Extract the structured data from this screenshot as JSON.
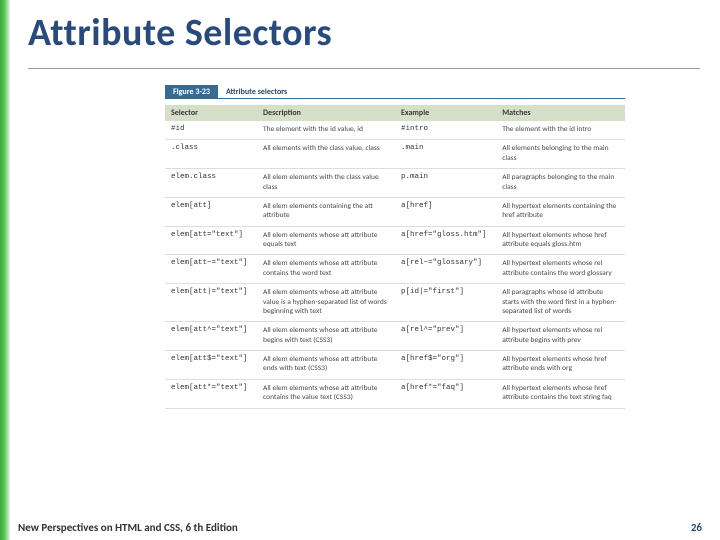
{
  "title": "Attribute Selectors",
  "figure": {
    "number": "Figure 3-23",
    "caption": "Attribute selectors",
    "headers": [
      "Selector",
      "Description",
      "Example",
      "Matches"
    ],
    "rows": [
      {
        "selector": "#id",
        "description": "The element with the id value, id",
        "example": "#intro",
        "matches": "The element with the id intro"
      },
      {
        "selector": ".class",
        "description": "All elements with the class value, class",
        "example": ".main",
        "matches": "All elements belonging to the main class"
      },
      {
        "selector": "elem.class",
        "description": "All elem elements with the class value class",
        "example": "p.main",
        "matches": "All paragraphs belonging to the main class"
      },
      {
        "selector": "elem[att]",
        "description": "All elem elements containing the att attribute",
        "example": "a[href]",
        "matches": "All hypertext elements containing the href attribute"
      },
      {
        "selector": "elem[att=\"text\"]",
        "description": "All elem elements whose att attribute equals text",
        "example": "a[href=\"gloss.htm\"]",
        "matches": "All hypertext elements whose href attribute equals gloss.htm"
      },
      {
        "selector": "elem[att~=\"text\"]",
        "description": "All elem elements whose att attribute contains the word text",
        "example": "a[rel~=\"glossary\"]",
        "matches": "All hypertext elements whose rel attribute contains the word glossary"
      },
      {
        "selector": "elem[att|=\"text\"]",
        "description": "All elem elements whose att attribute value is a hyphen-separated list of words beginning with text",
        "example": "p[id|=\"first\"]",
        "matches": "All paragraphs whose id attribute starts with the word first in a hyphen-separated list of words"
      },
      {
        "selector": "elem[att^=\"text\"]",
        "description": "All elem elements whose att attribute begins with text (CSS3)",
        "example": "a[rel^=\"prev\"]",
        "matches": "All hypertext elements whose rel attribute begins with prev"
      },
      {
        "selector": "elem[att$=\"text\"]",
        "description": "All elem elements whose att attribute ends with text (CSS3)",
        "example": "a[href$=\"org\"]",
        "matches": "All hypertext elements whose href attribute ends with org"
      },
      {
        "selector": "elem[att*=\"text\"]",
        "description": "All elem elements whose att attribute contains the value text (CSS3)",
        "example": "a[href*=\"faq\"]",
        "matches": "All hypertext elements whose href attribute contains the text string faq"
      }
    ]
  },
  "footer": {
    "left": "New Perspectives on HTML and CSS, 6 th Edition",
    "right": "26"
  }
}
